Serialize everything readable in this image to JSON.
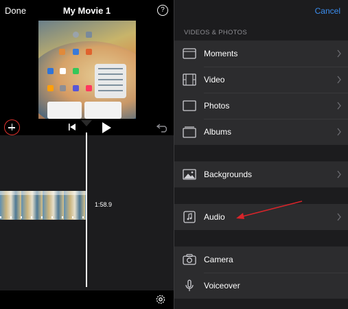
{
  "left_pane": {
    "done_label": "Done",
    "title": "My Movie 1",
    "help_label": "?",
    "clip_duration": "1:58.9"
  },
  "right_pane": {
    "cancel_label": "Cancel",
    "section_header": "VIDEOS & PHOTOS",
    "items": [
      {
        "label": "Moments",
        "icon": "moments-icon"
      },
      {
        "label": "Video",
        "icon": "film-icon"
      },
      {
        "label": "Photos",
        "icon": "photo-frame-icon"
      },
      {
        "label": "Albums",
        "icon": "albums-icon"
      },
      {
        "label": "Backgrounds",
        "icon": "image-icon"
      },
      {
        "label": "Audio",
        "icon": "music-note-icon"
      },
      {
        "label": "Camera",
        "icon": "camera-icon"
      },
      {
        "label": "Voiceover",
        "icon": "microphone-icon"
      }
    ]
  },
  "colors": {
    "accent": "#3b8ef0",
    "highlight_circle": "#e0322d",
    "annotation_arrow": "#d9242a"
  }
}
